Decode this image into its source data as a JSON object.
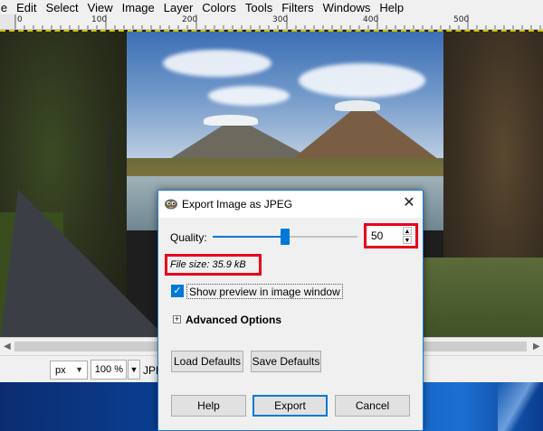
{
  "menubar": {
    "items": [
      "le",
      "Edit",
      "Select",
      "View",
      "Image",
      "Layer",
      "Colors",
      "Tools",
      "Filters",
      "Windows",
      "Help"
    ]
  },
  "ruler": {
    "labels": [
      "0",
      "100",
      "200",
      "300",
      "400",
      "500"
    ]
  },
  "statusbar": {
    "unit": "px",
    "zoom": "100 %",
    "text": "JPEG"
  },
  "dialog": {
    "title": "Export Image as JPEG",
    "quality_label": "Quality:",
    "quality_value": "50",
    "quality_fraction": 0.5,
    "file_size": "File size: 35.9 kB",
    "show_preview_label": "Show preview in image window",
    "show_preview_checked": true,
    "advanced_options_label": "Advanced Options",
    "advanced_expander": "+",
    "load_defaults": "Load Defaults",
    "save_defaults": "Save Defaults",
    "help": "Help",
    "export": "Export",
    "cancel": "Cancel"
  },
  "colors": {
    "accent": "#0078d7",
    "highlight_box": "#e8001c"
  },
  "icons": {
    "close": "close-icon",
    "app": "gimp-icon",
    "check": "checkmark-icon"
  }
}
